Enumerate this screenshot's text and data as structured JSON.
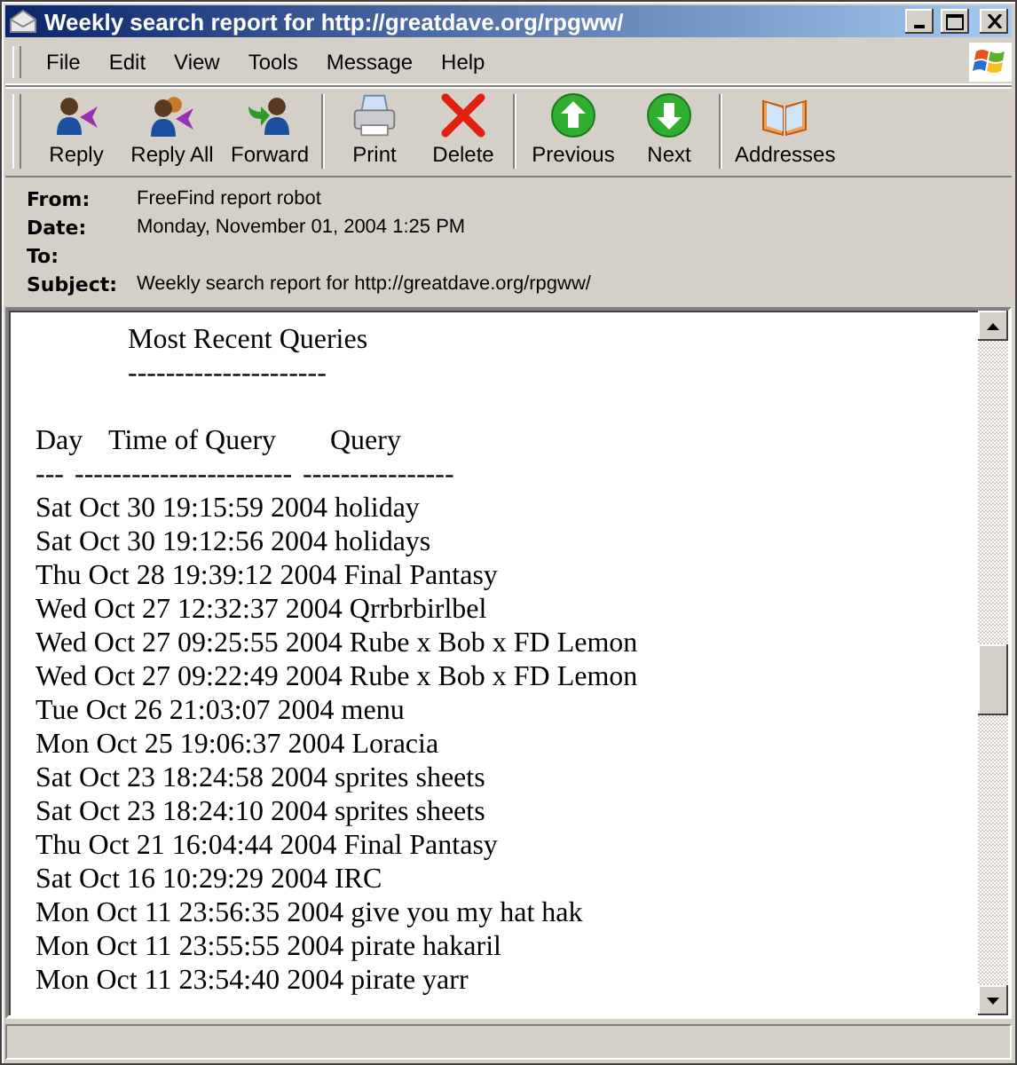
{
  "window": {
    "title": "Weekly search report for http://greatdave.org/rpgww/"
  },
  "menu": [
    "File",
    "Edit",
    "View",
    "Tools",
    "Message",
    "Help"
  ],
  "toolbar": [
    [
      {
        "label": "Reply"
      },
      {
        "label": "Reply All"
      },
      {
        "label": "Forward"
      }
    ],
    [
      {
        "label": "Print"
      },
      {
        "label": "Delete"
      }
    ],
    [
      {
        "label": "Previous"
      },
      {
        "label": "Next"
      }
    ],
    [
      {
        "label": "Addresses"
      }
    ]
  ],
  "headers": [
    {
      "label": "From:",
      "value": "FreeFind report robot"
    },
    {
      "label": "Date:",
      "value": "Monday, November 01, 2004 1:25 PM"
    },
    {
      "label": "To:"
    },
    {
      "label": "Subject:",
      "value": "Weekly search report for http://greatdave.org/rpgww/"
    }
  ],
  "message": {
    "title": "Most Recent Queries",
    "title_rule": "---------------------",
    "columns": [
      {
        "heading": "Day",
        "rule": "---"
      },
      {
        "heading": "Time of Query",
        "rule": "-----------------------"
      },
      {
        "heading": "Query",
        "rule": "----------------"
      }
    ],
    "rows": [
      "Sat Oct 30 19:15:59 2004 holiday",
      "Sat Oct 30 19:12:56 2004 holidays",
      "Thu Oct 28 19:39:12 2004 Final Pantasy",
      "Wed Oct 27 12:32:37 2004 Qrrbrbirlbel",
      "Wed Oct 27 09:25:55 2004 Rube x Bob x FD Lemon",
      "Wed Oct 27 09:22:49 2004 Rube x Bob x FD Lemon",
      "Tue Oct 26 21:03:07 2004 menu",
      "Mon Oct 25 19:06:37 2004 Loracia",
      "Sat Oct 23 18:24:58 2004 sprites sheets",
      "Sat Oct 23 18:24:10 2004 sprites sheets",
      "Thu Oct 21 16:04:44 2004 Final Pantasy",
      "Sat Oct 16 10:29:29 2004 IRC",
      "Mon Oct 11 23:56:35 2004 give you my hat hak",
      "Mon Oct 11 23:55:55 2004 pirate hakaril",
      "Mon Oct 11 23:54:40 2004 pirate yarr"
    ]
  }
}
